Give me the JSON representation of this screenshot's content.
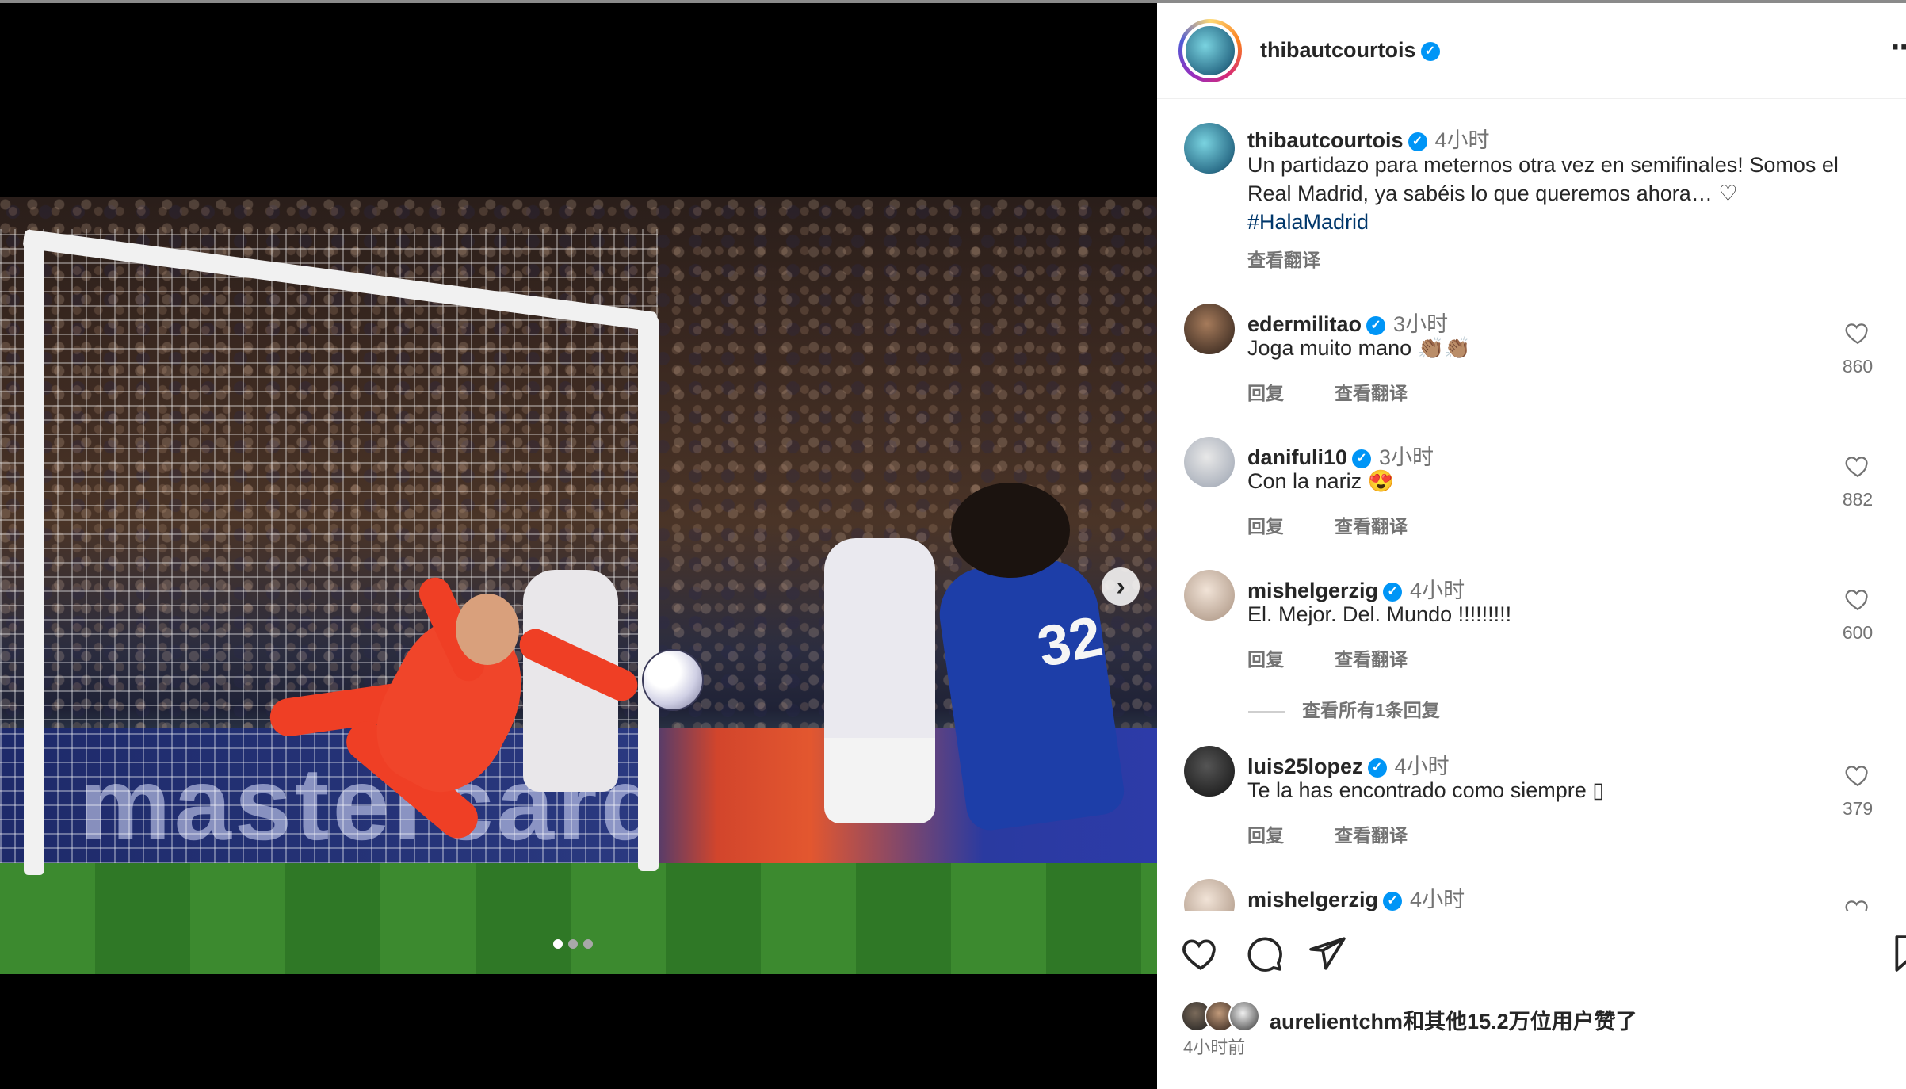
{
  "post": {
    "username": "thibautcourtois",
    "verified": true,
    "carousel": {
      "current_index": 1,
      "total": 3
    }
  },
  "caption": {
    "username": "thibautcourtois",
    "time": "4小时",
    "text": "Un partidazo para meternos otra vez en semifinales! Somos el Real Madrid, ya sabéis lo que queremos ahora… ♡",
    "hashtag": "#HalaMadrid",
    "translate": "查看翻译"
  },
  "comments": [
    {
      "username": "edermilitao",
      "time": "3小时",
      "text": "Joga muito mano 👏🏽👏🏽",
      "reply": "回复",
      "translate": "查看翻译",
      "likes": "860"
    },
    {
      "username": "danifuli10",
      "time": "3小时",
      "text": "Con la nariz 😍",
      "reply": "回复",
      "translate": "查看翻译",
      "likes": "882"
    },
    {
      "username": "mishelgerzig",
      "time": "4小时",
      "text": "El. Mejor. Del. Mundo !!!!!!!!!",
      "reply": "回复",
      "translate": "查看翻译",
      "likes": "600"
    },
    {
      "username": "luis25lopez",
      "time": "4小时",
      "text": "Te la has encontrado como siempre ▯",
      "reply": "回复",
      "translate": "查看翻译",
      "likes": "379"
    },
    {
      "username": "mishelgerzig",
      "time": "4小时"
    }
  ],
  "view_replies": "查看所有1条回复",
  "footer": {
    "likes_user": "aurelientchm",
    "likes_text": "和其他15.2万位用户赞了",
    "posted": "4小时前"
  },
  "icons": [
    "heart-icon",
    "comment-icon",
    "share-icon",
    "bookmark-icon",
    "more-icon",
    "verified-icon",
    "next-arrow-icon"
  ],
  "colors": {
    "link": "#00376b",
    "verified": "#0095f6",
    "secondary_text": "#737373",
    "primary_text": "#262626"
  }
}
